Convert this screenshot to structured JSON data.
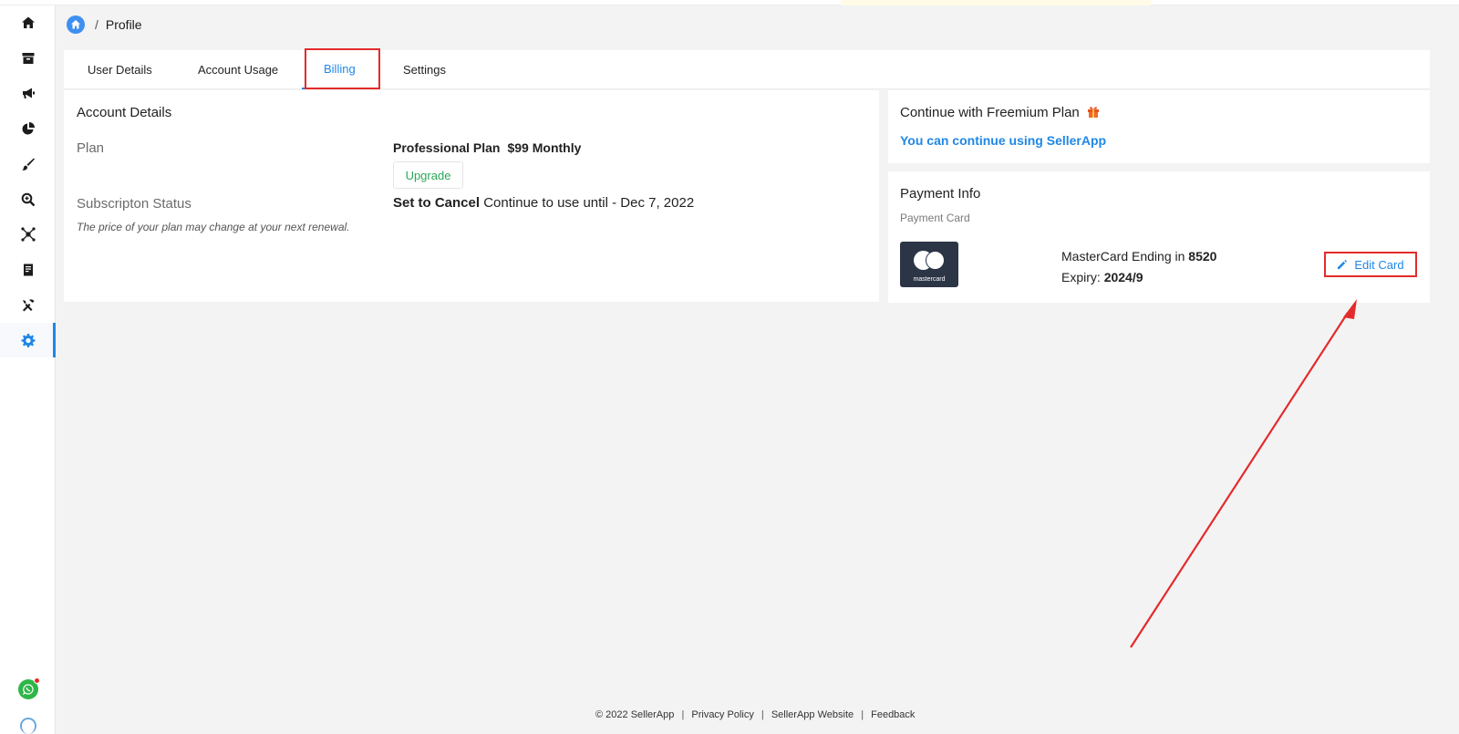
{
  "breadcrumb": {
    "separator": "/",
    "current": "Profile"
  },
  "tabs": [
    {
      "label": "User Details",
      "active": false
    },
    {
      "label": "Account Usage",
      "active": false
    },
    {
      "label": "Billing",
      "active": true
    },
    {
      "label": "Settings",
      "active": false
    }
  ],
  "account": {
    "title": "Account Details",
    "plan_label": "Plan",
    "plan_name": "Professional Plan",
    "plan_price": "$99 Monthly",
    "upgrade_label": "Upgrade",
    "status_label": "Subscripton Status",
    "status_value": "Set to Cancel",
    "status_detail": "Continue to use until - Dec 7, 2022",
    "note": "The price of your plan may change at your next renewal."
  },
  "freemium": {
    "title": "Continue with Freemium Plan",
    "link": "You can continue using SellerApp"
  },
  "payment": {
    "title": "Payment Info",
    "subtitle": "Payment Card",
    "card_logo_text": "mastercard",
    "card_prefix": "MasterCard Ending in",
    "card_last4": "8520",
    "expiry_label": "Expiry:",
    "expiry_value": "2024/9",
    "edit_label": "Edit Card"
  },
  "footer": {
    "copyright": "© 2022 SellerApp",
    "privacy": "Privacy Policy",
    "website": "SellerApp Website",
    "feedback": "Feedback",
    "separator": "|"
  },
  "colors": {
    "accent": "#1f87e5",
    "success": "#2aa85a",
    "highlight": "#e42b2b",
    "card_logo_bg": "#2b3546"
  },
  "sidebar_icons": [
    "home-icon",
    "archive-icon",
    "megaphone-icon",
    "pie-chart-icon",
    "brush-icon",
    "zoom-search-icon",
    "network-icon",
    "document-icon",
    "tools-icon",
    "gear-icon"
  ]
}
